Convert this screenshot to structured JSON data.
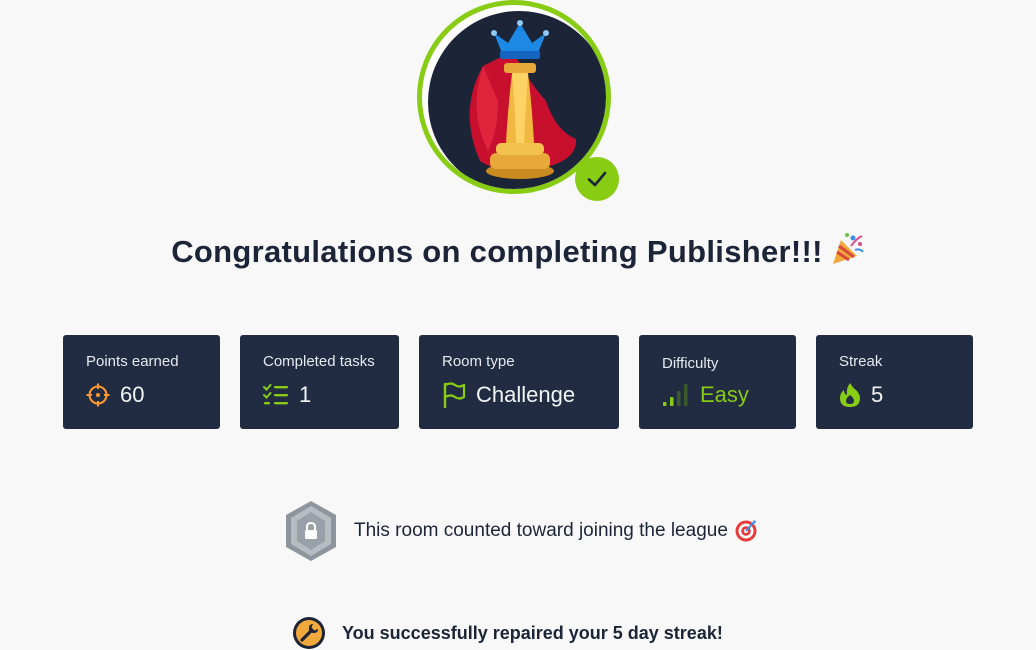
{
  "avatar": {
    "alt": "chess king",
    "status": "completed"
  },
  "title": "Congratulations on completing Publisher!!!",
  "stats": [
    {
      "label": "Points earned",
      "value": "60",
      "icon": "crosshair-icon"
    },
    {
      "label": "Completed tasks",
      "value": "1",
      "icon": "task-list-icon"
    },
    {
      "label": "Room type",
      "value": "Challenge",
      "icon": "flag-icon"
    },
    {
      "label": "Difficulty",
      "value": "Easy",
      "icon": "signal-bars-icon"
    },
    {
      "label": "Streak",
      "value": "5",
      "icon": "flame-icon"
    }
  ],
  "league": {
    "text": "This room counted toward joining the league"
  },
  "streak_repair": {
    "text": "You successfully repaired your 5 day streak!"
  },
  "colors": {
    "accent": "#88cc14",
    "card": "#212c42",
    "icon_orange": "#ff9a2e"
  }
}
